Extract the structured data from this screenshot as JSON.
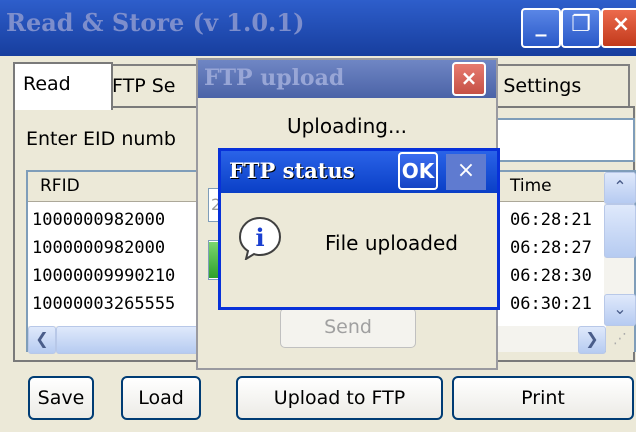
{
  "main_window": {
    "title": "Read & Store (v 1.0.1)",
    "minimize_glyph": "_",
    "restore_glyph": "❐",
    "close_glyph": "×"
  },
  "tabs": [
    {
      "label": "Read"
    },
    {
      "label": "FTP Se"
    },
    {
      "label": "'S Settings"
    }
  ],
  "read_tab": {
    "eid_label": "Enter EID numb",
    "columns": {
      "rfid": "RFID",
      "time": "Time"
    },
    "rows": [
      {
        "rfid": "1000000982000",
        "time": "06:28:21"
      },
      {
        "rfid": "1000000982000",
        "time": "06:28:27"
      },
      {
        "rfid": "10000009990210",
        "time": "06:28:30"
      },
      {
        "rfid": "10000003265555",
        "time": "06:30:21"
      }
    ]
  },
  "scroll_glyphs": {
    "up": "⌃",
    "down": "⌄",
    "left": "❮",
    "right": "❯",
    "grip": "⋰"
  },
  "bottom_buttons": {
    "save": "Save",
    "load": "Load",
    "upload": "Upload to FTP",
    "print": "Print"
  },
  "ftp_upload_dialog": {
    "title": "FTP upload",
    "close_glyph": "×",
    "status": "Uploading...",
    "field_value": "2",
    "send_label": "Send"
  },
  "ftp_status_box": {
    "title": "FTP status",
    "ok_label": "OK",
    "close_glyph": "×",
    "message": "File uploaded",
    "icon": "info-icon",
    "icon_glyph": "i"
  },
  "colors": {
    "title_bar": "#2e5ecb",
    "message_title_bar": "#0a3fc6",
    "progress": "#2ea12a"
  }
}
